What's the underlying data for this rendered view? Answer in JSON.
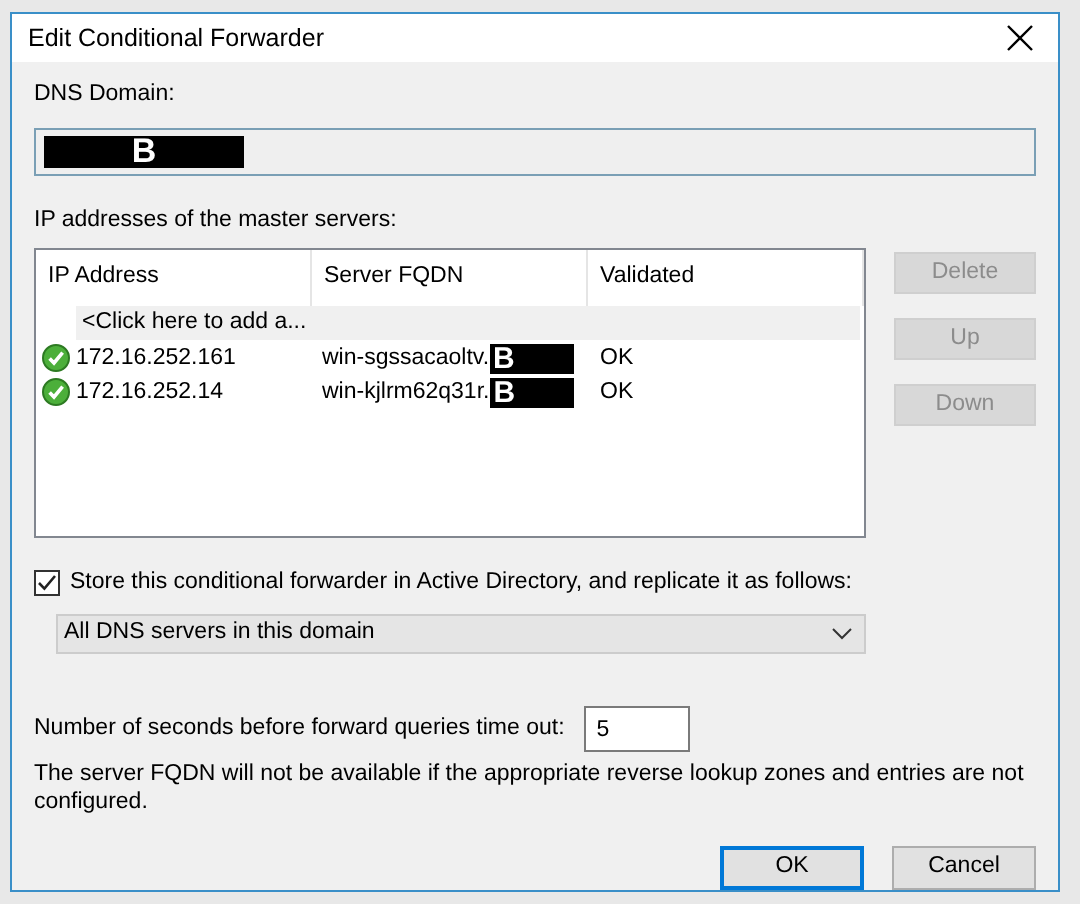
{
  "window": {
    "title": "Edit Conditional Forwarder"
  },
  "dns_domain": {
    "label": "DNS Domain:",
    "redaction": "B"
  },
  "servers": {
    "label": "IP addresses of the master servers:",
    "columns": [
      "IP Address",
      "Server FQDN",
      "Validated"
    ],
    "add_row": "<Click here to add a...",
    "rows": [
      {
        "ip": "172.16.252.161",
        "fqdn": "win-sgssacaoltv.",
        "redaction": "B",
        "validated": "OK",
        "valid": true
      },
      {
        "ip": "172.16.252.14",
        "fqdn": "win-kjlrm62q31r.",
        "redaction": "B",
        "validated": "OK",
        "valid": true
      }
    ],
    "buttons": [
      {
        "label": "Delete",
        "disabled": true
      },
      {
        "label": "Up",
        "disabled": true
      },
      {
        "label": "Down",
        "disabled": true
      }
    ]
  },
  "store": {
    "label": "Store this conditional forwarder in Active Directory, and replicate it as follows:",
    "checked": true
  },
  "replication": {
    "value": "All DNS servers in this domain"
  },
  "timeout": {
    "label": "Number of seconds before forward queries time out:",
    "value": "5"
  },
  "note": "The server FQDN will not be available if the appropriate reverse lookup zones and entries are not configured.",
  "footer_buttons": [
    {
      "label": "OK",
      "default": true
    },
    {
      "label": "Cancel",
      "default": false
    }
  ]
}
